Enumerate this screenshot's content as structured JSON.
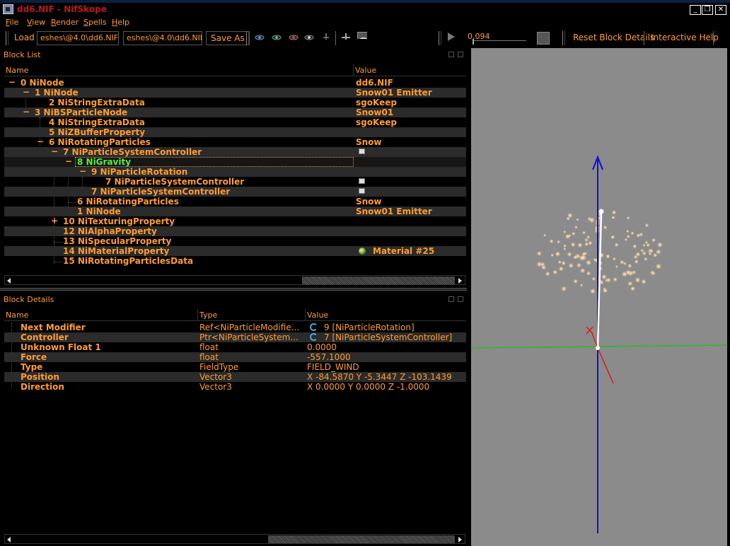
{
  "window": {
    "title": "dd6.NIF - NifSkope",
    "minimize": "_",
    "restore": "❐",
    "close": "✕"
  },
  "menu": {
    "file": {
      "ul": "F",
      "rest": "ile"
    },
    "view": {
      "ul": "V",
      "rest": "iew"
    },
    "render": {
      "ul": "R",
      "rest": "ender"
    },
    "spells": {
      "ul": "S",
      "rest": "pells"
    },
    "help": {
      "ul": "H",
      "rest": "elp"
    }
  },
  "toolbar": {
    "load_label": "Load",
    "load_path_1": "eshes\\@4.0\\dd6.NIF",
    "load_path_2": "eshes\\@4.0\\dd6.NIF",
    "save_as_label": "Save As",
    "time_value": "0.094",
    "reset_block_details": "Reset Block Details",
    "interactive_help": "Interactive Help"
  },
  "block_list": {
    "title": "Block List",
    "columns": {
      "name": "Name",
      "value": "Value"
    },
    "rows": [
      {
        "name": "0 NiNode",
        "value": "dd6.NIF"
      },
      {
        "name": "1 NiNode",
        "value": "Snow01 Emitter"
      },
      {
        "name": "2 NiStringExtraData",
        "value": "sgoKeep"
      },
      {
        "name": "3 NiBSParticleNode",
        "value": "Snow01"
      },
      {
        "name": "4 NiStringExtraData",
        "value": "sgoKeep"
      },
      {
        "name": "5 NiZBufferProperty",
        "value": ""
      },
      {
        "name": "6 NiRotatingParticles",
        "value": "Snow"
      },
      {
        "name": "7 NiParticleSystemController",
        "value": ""
      },
      {
        "name": "8 NiGravity",
        "value": ""
      },
      {
        "name": "9 NiParticleRotation",
        "value": ""
      },
      {
        "name": "7 NiParticleSystemController",
        "value": ""
      },
      {
        "name": "7 NiParticleSystemController",
        "value": ""
      },
      {
        "name": "6 NiRotatingParticles",
        "value": "Snow"
      },
      {
        "name": "1 NiNode",
        "value": "Snow01 Emitter"
      },
      {
        "name": "10 NiTexturingProperty",
        "value": ""
      },
      {
        "name": "12 NiAlphaProperty",
        "value": ""
      },
      {
        "name": "13 NiSpecularProperty",
        "value": ""
      },
      {
        "name": "14 NiMaterialProperty",
        "value": "Material #25"
      },
      {
        "name": "15 NiRotatingParticlesData",
        "value": ""
      }
    ],
    "toggles": {
      "collapse": "−",
      "expand": "+"
    }
  },
  "block_details": {
    "title": "Block Details",
    "columns": {
      "name": "Name",
      "type": "Type",
      "value": "Value"
    },
    "rows": [
      {
        "name": "Next Modifier",
        "type": "Ref<NiParticleModifie...",
        "value": "9 [NiParticleRotation]"
      },
      {
        "name": "Controller",
        "type": "Ptr<NiParticleSystem...",
        "value": "7 [NiParticleSystemController]"
      },
      {
        "name": "Unknown Float 1",
        "type": "float",
        "value": "0.0000"
      },
      {
        "name": "Force",
        "type": "float",
        "value": "-557.1000"
      },
      {
        "name": "Type",
        "type": "FieldType",
        "value": "FIELD_WIND"
      },
      {
        "name": "Position",
        "type": "Vector3",
        "value": "X -84.5870 Y -5.3447 Z -103.1439"
      },
      {
        "name": "Direction",
        "type": "Vector3",
        "value": "X 0.0000 Y 0.0000 Z -1.0000"
      }
    ]
  },
  "colors": {
    "accent": "#ff9d2e",
    "selected_text": "#57f040",
    "title_red": "#c01818",
    "viewport_bg": "#8b8b8b",
    "axis_blue": "#1010d0",
    "axis_green": "#20c020",
    "axis_red": "#e01818"
  }
}
